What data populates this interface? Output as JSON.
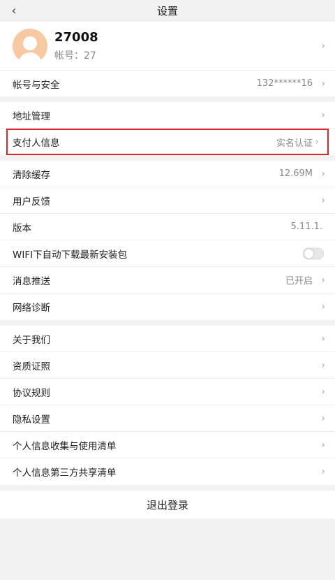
{
  "header": {
    "back_icon": "chevron-left-icon",
    "title": "设置"
  },
  "profile": {
    "name": "2700‌8",
    "account_label": "帐号：2‌7"
  },
  "account_security": {
    "label": "帐号与安全",
    "value": "132******16"
  },
  "address": {
    "label": "地址管理"
  },
  "payer": {
    "label": "支付人信息",
    "value": "实名认证"
  },
  "cache": {
    "label": "清除缓存",
    "value": "12.69M"
  },
  "feedback": {
    "label": "用户反馈"
  },
  "version": {
    "label": "版本",
    "value": "5.11.1."
  },
  "wifi_download": {
    "label": "WIFI下自动下载最新安装包",
    "enabled": false
  },
  "push": {
    "label": "消息推送",
    "value": "已开启"
  },
  "network": {
    "label": "网络诊断"
  },
  "about": {
    "label": "关于我们"
  },
  "qualification": {
    "label": "资质证照"
  },
  "agreement": {
    "label": "协议规则"
  },
  "privacy": {
    "label": "隐私设置"
  },
  "personal_info_list": {
    "label": "个人信息收集与使用清单"
  },
  "third_party_list": {
    "label": "个人信息第三方共享清单"
  },
  "logout": {
    "label": "退出登录"
  },
  "colors": {
    "highlight_border": "#e0242a",
    "avatar_bg": "#f6c9a3"
  }
}
